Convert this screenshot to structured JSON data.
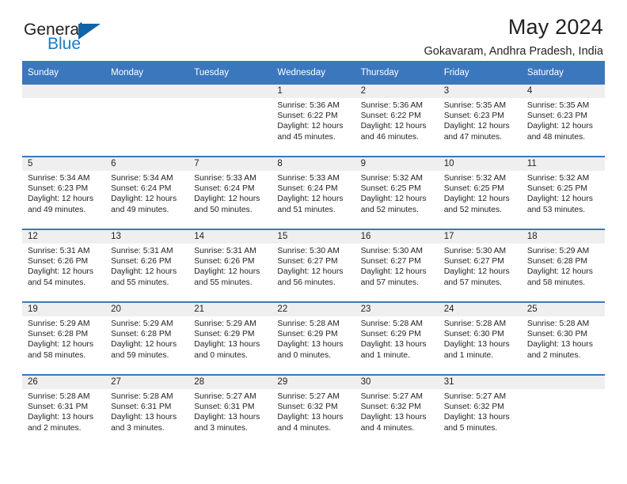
{
  "brand": {
    "name_top": "General",
    "name_bottom": "Blue",
    "accent_color": "#1064A8",
    "text_color": "#231F20"
  },
  "header": {
    "title": "May 2024",
    "subtitle": "Gokavaram, Andhra Pradesh, India"
  },
  "theme": {
    "header_bg": "#3B77BD",
    "header_text": "#FFFFFF",
    "daynum_band_bg": "#EFEFEF",
    "cell_bg": "#FFFFFF",
    "row_divider": "#3B77BD"
  },
  "weekday_headers": [
    "Sunday",
    "Monday",
    "Tuesday",
    "Wednesday",
    "Thursday",
    "Friday",
    "Saturday"
  ],
  "labels": {
    "sunrise_prefix": "Sunrise:",
    "sunset_prefix": "Sunset:",
    "daylight_prefix": "Daylight:"
  },
  "weeks": [
    [
      {
        "day": "",
        "sunrise": "",
        "sunset": "",
        "daylight_1": "",
        "daylight_2": "",
        "empty": true
      },
      {
        "day": "",
        "sunrise": "",
        "sunset": "",
        "daylight_1": "",
        "daylight_2": "",
        "empty": true
      },
      {
        "day": "",
        "sunrise": "",
        "sunset": "",
        "daylight_1": "",
        "daylight_2": "",
        "empty": true
      },
      {
        "day": "1",
        "sunrise": "Sunrise: 5:36 AM",
        "sunset": "Sunset: 6:22 PM",
        "daylight_1": "Daylight: 12 hours",
        "daylight_2": "and 45 minutes.",
        "empty": false
      },
      {
        "day": "2",
        "sunrise": "Sunrise: 5:36 AM",
        "sunset": "Sunset: 6:22 PM",
        "daylight_1": "Daylight: 12 hours",
        "daylight_2": "and 46 minutes.",
        "empty": false
      },
      {
        "day": "3",
        "sunrise": "Sunrise: 5:35 AM",
        "sunset": "Sunset: 6:23 PM",
        "daylight_1": "Daylight: 12 hours",
        "daylight_2": "and 47 minutes.",
        "empty": false
      },
      {
        "day": "4",
        "sunrise": "Sunrise: 5:35 AM",
        "sunset": "Sunset: 6:23 PM",
        "daylight_1": "Daylight: 12 hours",
        "daylight_2": "and 48 minutes.",
        "empty": false
      }
    ],
    [
      {
        "day": "5",
        "sunrise": "Sunrise: 5:34 AM",
        "sunset": "Sunset: 6:23 PM",
        "daylight_1": "Daylight: 12 hours",
        "daylight_2": "and 49 minutes.",
        "empty": false
      },
      {
        "day": "6",
        "sunrise": "Sunrise: 5:34 AM",
        "sunset": "Sunset: 6:24 PM",
        "daylight_1": "Daylight: 12 hours",
        "daylight_2": "and 49 minutes.",
        "empty": false
      },
      {
        "day": "7",
        "sunrise": "Sunrise: 5:33 AM",
        "sunset": "Sunset: 6:24 PM",
        "daylight_1": "Daylight: 12 hours",
        "daylight_2": "and 50 minutes.",
        "empty": false
      },
      {
        "day": "8",
        "sunrise": "Sunrise: 5:33 AM",
        "sunset": "Sunset: 6:24 PM",
        "daylight_1": "Daylight: 12 hours",
        "daylight_2": "and 51 minutes.",
        "empty": false
      },
      {
        "day": "9",
        "sunrise": "Sunrise: 5:32 AM",
        "sunset": "Sunset: 6:25 PM",
        "daylight_1": "Daylight: 12 hours",
        "daylight_2": "and 52 minutes.",
        "empty": false
      },
      {
        "day": "10",
        "sunrise": "Sunrise: 5:32 AM",
        "sunset": "Sunset: 6:25 PM",
        "daylight_1": "Daylight: 12 hours",
        "daylight_2": "and 52 minutes.",
        "empty": false
      },
      {
        "day": "11",
        "sunrise": "Sunrise: 5:32 AM",
        "sunset": "Sunset: 6:25 PM",
        "daylight_1": "Daylight: 12 hours",
        "daylight_2": "and 53 minutes.",
        "empty": false
      }
    ],
    [
      {
        "day": "12",
        "sunrise": "Sunrise: 5:31 AM",
        "sunset": "Sunset: 6:26 PM",
        "daylight_1": "Daylight: 12 hours",
        "daylight_2": "and 54 minutes.",
        "empty": false
      },
      {
        "day": "13",
        "sunrise": "Sunrise: 5:31 AM",
        "sunset": "Sunset: 6:26 PM",
        "daylight_1": "Daylight: 12 hours",
        "daylight_2": "and 55 minutes.",
        "empty": false
      },
      {
        "day": "14",
        "sunrise": "Sunrise: 5:31 AM",
        "sunset": "Sunset: 6:26 PM",
        "daylight_1": "Daylight: 12 hours",
        "daylight_2": "and 55 minutes.",
        "empty": false
      },
      {
        "day": "15",
        "sunrise": "Sunrise: 5:30 AM",
        "sunset": "Sunset: 6:27 PM",
        "daylight_1": "Daylight: 12 hours",
        "daylight_2": "and 56 minutes.",
        "empty": false
      },
      {
        "day": "16",
        "sunrise": "Sunrise: 5:30 AM",
        "sunset": "Sunset: 6:27 PM",
        "daylight_1": "Daylight: 12 hours",
        "daylight_2": "and 57 minutes.",
        "empty": false
      },
      {
        "day": "17",
        "sunrise": "Sunrise: 5:30 AM",
        "sunset": "Sunset: 6:27 PM",
        "daylight_1": "Daylight: 12 hours",
        "daylight_2": "and 57 minutes.",
        "empty": false
      },
      {
        "day": "18",
        "sunrise": "Sunrise: 5:29 AM",
        "sunset": "Sunset: 6:28 PM",
        "daylight_1": "Daylight: 12 hours",
        "daylight_2": "and 58 minutes.",
        "empty": false
      }
    ],
    [
      {
        "day": "19",
        "sunrise": "Sunrise: 5:29 AM",
        "sunset": "Sunset: 6:28 PM",
        "daylight_1": "Daylight: 12 hours",
        "daylight_2": "and 58 minutes.",
        "empty": false
      },
      {
        "day": "20",
        "sunrise": "Sunrise: 5:29 AM",
        "sunset": "Sunset: 6:28 PM",
        "daylight_1": "Daylight: 12 hours",
        "daylight_2": "and 59 minutes.",
        "empty": false
      },
      {
        "day": "21",
        "sunrise": "Sunrise: 5:29 AM",
        "sunset": "Sunset: 6:29 PM",
        "daylight_1": "Daylight: 13 hours",
        "daylight_2": "and 0 minutes.",
        "empty": false
      },
      {
        "day": "22",
        "sunrise": "Sunrise: 5:28 AM",
        "sunset": "Sunset: 6:29 PM",
        "daylight_1": "Daylight: 13 hours",
        "daylight_2": "and 0 minutes.",
        "empty": false
      },
      {
        "day": "23",
        "sunrise": "Sunrise: 5:28 AM",
        "sunset": "Sunset: 6:29 PM",
        "daylight_1": "Daylight: 13 hours",
        "daylight_2": "and 1 minute.",
        "empty": false
      },
      {
        "day": "24",
        "sunrise": "Sunrise: 5:28 AM",
        "sunset": "Sunset: 6:30 PM",
        "daylight_1": "Daylight: 13 hours",
        "daylight_2": "and 1 minute.",
        "empty": false
      },
      {
        "day": "25",
        "sunrise": "Sunrise: 5:28 AM",
        "sunset": "Sunset: 6:30 PM",
        "daylight_1": "Daylight: 13 hours",
        "daylight_2": "and 2 minutes.",
        "empty": false
      }
    ],
    [
      {
        "day": "26",
        "sunrise": "Sunrise: 5:28 AM",
        "sunset": "Sunset: 6:31 PM",
        "daylight_1": "Daylight: 13 hours",
        "daylight_2": "and 2 minutes.",
        "empty": false
      },
      {
        "day": "27",
        "sunrise": "Sunrise: 5:28 AM",
        "sunset": "Sunset: 6:31 PM",
        "daylight_1": "Daylight: 13 hours",
        "daylight_2": "and 3 minutes.",
        "empty": false
      },
      {
        "day": "28",
        "sunrise": "Sunrise: 5:27 AM",
        "sunset": "Sunset: 6:31 PM",
        "daylight_1": "Daylight: 13 hours",
        "daylight_2": "and 3 minutes.",
        "empty": false
      },
      {
        "day": "29",
        "sunrise": "Sunrise: 5:27 AM",
        "sunset": "Sunset: 6:32 PM",
        "daylight_1": "Daylight: 13 hours",
        "daylight_2": "and 4 minutes.",
        "empty": false
      },
      {
        "day": "30",
        "sunrise": "Sunrise: 5:27 AM",
        "sunset": "Sunset: 6:32 PM",
        "daylight_1": "Daylight: 13 hours",
        "daylight_2": "and 4 minutes.",
        "empty": false
      },
      {
        "day": "31",
        "sunrise": "Sunrise: 5:27 AM",
        "sunset": "Sunset: 6:32 PM",
        "daylight_1": "Daylight: 13 hours",
        "daylight_2": "and 5 minutes.",
        "empty": false
      },
      {
        "day": "",
        "sunrise": "",
        "sunset": "",
        "daylight_1": "",
        "daylight_2": "",
        "empty": true
      }
    ]
  ]
}
